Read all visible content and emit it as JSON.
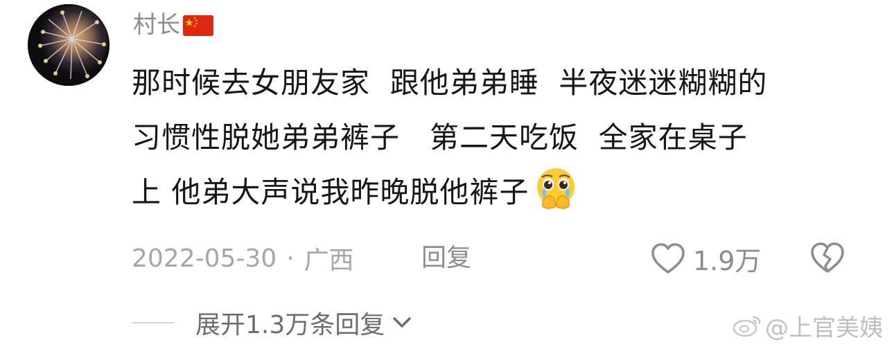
{
  "comment": {
    "username": "村长",
    "flag_icon": "china-flag-icon",
    "text_lines": [
      "那时候去女朋友家  跟他弟弟睡  半夜迷迷糊糊的",
      "习惯性脱她弟弟裤子   第二天吃饭  全家在桌子",
      "上 他弟大声说我昨晚脱他裤子"
    ],
    "emoji": "pleading-face-with-hands-emoji",
    "date": "2022-05-30",
    "separator": "·",
    "region": "广西",
    "reply_label": "回复",
    "like_count": "1.9万",
    "like_icon": "heart-outline-icon",
    "dislike_icon": "broken-heart-icon",
    "expand_label": "展开1.3万条回复",
    "expand_icon": "chevron-down-icon"
  },
  "watermark": {
    "text": "@上官美姨",
    "icon": "weibo-logo-icon"
  },
  "colors": {
    "text_primary": "#161616",
    "text_secondary": "#8c8c8c",
    "text_meta": "#a6a6a6",
    "flag_red": "#de2910",
    "flag_yellow": "#ffde00"
  }
}
